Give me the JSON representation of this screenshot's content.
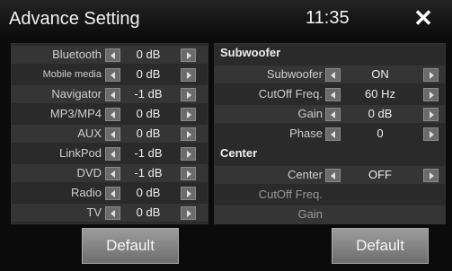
{
  "header": {
    "title": "Advance Setting",
    "clock": "11:35",
    "close_icon": "close-icon"
  },
  "mix": [
    {
      "label": "Bluetooth",
      "value": "0 dB"
    },
    {
      "label": "Mobile media",
      "value": "0 dB"
    },
    {
      "label": "Navigator",
      "value": "-1 dB"
    },
    {
      "label": "MP3/MP4",
      "value": "0 dB"
    },
    {
      "label": "AUX",
      "value": "0 dB"
    },
    {
      "label": "LinkPod",
      "value": "-1 dB"
    },
    {
      "label": "DVD",
      "value": "-1 dB"
    },
    {
      "label": "Radio",
      "value": "0 dB"
    },
    {
      "label": "TV",
      "value": "0 dB"
    }
  ],
  "subwoofer": {
    "heading": "Subwoofer",
    "rows": [
      {
        "label": "Subwoofer",
        "value": "ON"
      },
      {
        "label": "CutOff Freq.",
        "value": "60 Hz"
      },
      {
        "label": "Gain",
        "value": "0 dB"
      },
      {
        "label": "Phase",
        "value": "0"
      }
    ]
  },
  "center": {
    "heading": "Center",
    "rows": [
      {
        "label": "Center",
        "value": "OFF"
      },
      {
        "label": "CutOff Freq.",
        "value": ""
      },
      {
        "label": "Gain",
        "value": ""
      }
    ]
  },
  "footer": {
    "left_default": "Default",
    "right_default": "Default"
  }
}
